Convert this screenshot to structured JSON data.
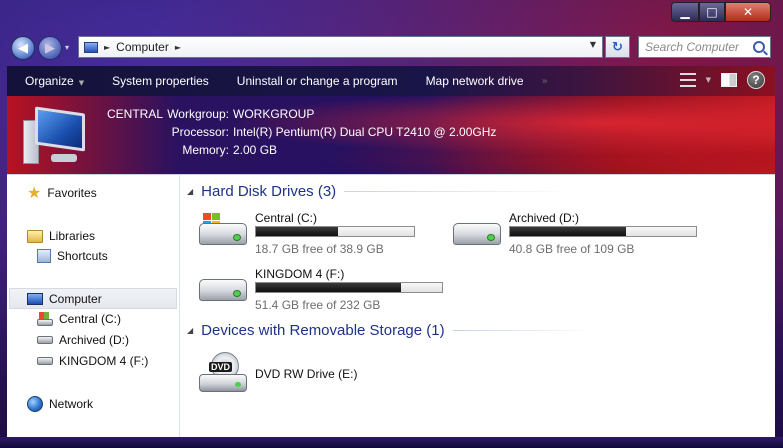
{
  "window": {
    "caption_buttons": {
      "minimize": "▁",
      "maximize": "□",
      "close": "✕"
    }
  },
  "nav": {
    "back_icon": "back-arrow-icon",
    "forward_icon": "forward-arrow-icon",
    "history_arrow": "▾",
    "address_separator": "►",
    "address_text": "Computer",
    "address_trailing_separator": "►",
    "address_dropdown": "▼",
    "refresh_glyph": "↻",
    "search_placeholder": "Search Computer"
  },
  "toolbar": {
    "organize": "Organize",
    "organize_arrow": "▼",
    "system_properties": "System properties",
    "uninstall": "Uninstall or change a program",
    "map_drive": "Map network drive",
    "more": "»",
    "view_arrow": "▼",
    "help": "?"
  },
  "details": {
    "computer_name": "CENTRAL",
    "workgroup_label": "Workgroup:",
    "workgroup_value": "WORKGROUP",
    "processor_label": "Processor:",
    "processor_value": "Intel(R) Pentium(R) Dual  CPU  T2410  @ 2.00GHz",
    "memory_label": "Memory:",
    "memory_value": "2.00 GB"
  },
  "nav_pane": {
    "favorites": "Favorites",
    "libraries": "Libraries",
    "shortcuts": "Shortcuts",
    "computer": "Computer",
    "drive_c": "Central (C:)",
    "drive_d": "Archived (D:)",
    "drive_f": "KINGDOM 4 (F:)",
    "network": "Network"
  },
  "main": {
    "hard_disks_header": "Hard Disk Drives (3)",
    "removable_header": "Devices with Removable Storage (1)",
    "collapse_glyph": "◢",
    "drives": [
      {
        "name": "Central (C:)",
        "free": "18.7 GB free of 38.9 GB",
        "used_fraction": 0.519
      },
      {
        "name": "Archived (D:)",
        "free": "40.8 GB free of 109 GB",
        "used_fraction": 0.626
      },
      {
        "name": "KINGDOM 4 (F:)",
        "free": "51.4 GB free of 232 GB",
        "used_fraction": 0.778
      }
    ],
    "removable": [
      {
        "name": "DVD RW Drive (E:)",
        "badge": "DVD"
      }
    ]
  },
  "colors": {
    "group_header": "#1e3287",
    "free_text": "#6d6d6d",
    "bar_fill": "#1a1a1a"
  }
}
